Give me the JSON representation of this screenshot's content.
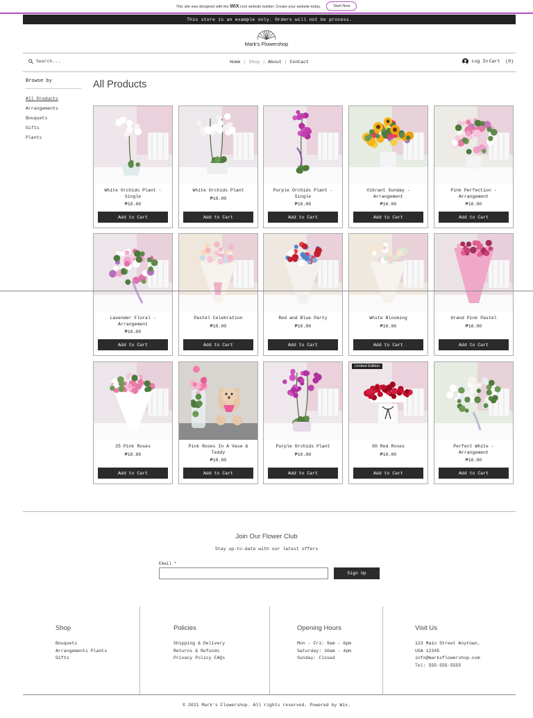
{
  "wix_bar": {
    "text_before": "This site was designed with the",
    "wix": "WiX",
    "text_after": ".com website builder. Create your website today.",
    "button": "Start Now"
  },
  "notice": "This store is an example only. Orders will not be process.",
  "brand": {
    "name": "Mark's Flowershop"
  },
  "nav": {
    "search_placeholder": "Search...",
    "menu": [
      "Home",
      "Shop",
      "About",
      "Contact"
    ],
    "login": "Log In",
    "cart": "Cart",
    "cart_count": "(0)"
  },
  "sidebar": {
    "title": "Browse by",
    "categories": [
      "All Products",
      "Arrangements",
      "Bouquets",
      "Gifts",
      "Plants"
    ]
  },
  "page_title": "All Products",
  "products": [
    {
      "name": "White Orchids Plant - Single",
      "price": "₱10.00",
      "kind": "orchid-white-single",
      "bg": "#eee6ea"
    },
    {
      "name": "White Orchids Plant",
      "price": "₱10.00",
      "kind": "orchid-white",
      "bg": "#ece8ec"
    },
    {
      "name": "Purple Orchids Plant - Single",
      "price": "₱10.00",
      "kind": "orchid-purple-single",
      "bg": "#eee8ec"
    },
    {
      "name": "Vibrant Sunday - Arrangement",
      "price": "₱10.00",
      "kind": "sunflower",
      "bg": "#e6ece2"
    },
    {
      "name": "Pink Perfection - Arrangement",
      "price": "₱10.00",
      "kind": "pink-mix",
      "bg": "#ecebe6"
    },
    {
      "name": "Lavender Floral - Arrangement",
      "price": "₱10.00",
      "kind": "lavender",
      "bg": "#ece6ea"
    },
    {
      "name": "Pastel Celebration",
      "price": "₱10.00",
      "kind": "pastel-bouquet",
      "bg": "#efe6dc"
    },
    {
      "name": "Red and Blue Party",
      "price": "₱10.00",
      "kind": "redblue-bouquet",
      "bg": "#eee8e0"
    },
    {
      "name": "White Blooming",
      "price": "₱10.00",
      "kind": "white-bouquet",
      "bg": "#efe8de"
    },
    {
      "name": "Grand Pink Pastel",
      "price": "₱10.00",
      "kind": "pink-bouquet",
      "bg": "#ebe2e6"
    },
    {
      "name": "25 Pink Roses",
      "price": "₱10.00",
      "kind": "pink-roses",
      "bg": "#ece6ea"
    },
    {
      "name": "Pink Roses In A Vase & Teddy",
      "price": "₱10.00",
      "kind": "teddy",
      "bg": "#d8d4d0"
    },
    {
      "name": "Purple Orchids Plant",
      "price": "₱10.00",
      "kind": "orchid-purple",
      "bg": "#eee8ec"
    },
    {
      "name": "50 Red Roses",
      "price": "₱10.00",
      "kind": "red-roses",
      "bg": "#efe6ea",
      "ribbon": "Limited Edition"
    },
    {
      "name": "Perfect White - Arrangement",
      "price": "₱10.00",
      "kind": "white-arrangement",
      "bg": "#e6ece2"
    }
  ],
  "add_to_cart": "Add to Cart",
  "club": {
    "title": "Join Our Flower Club",
    "subtitle": "Stay up-to-date with our latest offers",
    "email_label": "Email *",
    "signup": "Sign Up"
  },
  "footer": {
    "shop": {
      "title": "Shop",
      "lines": [
        "Bouquets",
        "Arrangements Plants",
        "Gifts"
      ]
    },
    "policies": {
      "title": "Policies",
      "lines": [
        "Shipping & Delivery",
        "Returns & Refunds",
        "Privacy Policy FAQs"
      ]
    },
    "hours": {
      "title": "Opening Hours",
      "lines": [
        "Mon - Fri: 9am - 6pm",
        "Saturday: 10am - 4pm",
        "Sunday: Closed"
      ]
    },
    "visit": {
      "title": "Visit Us",
      "lines": [
        "123 Main Street Anytown,",
        "USA 12345",
        "info@marksflowershop.com",
        "Tel: 555-555-5555"
      ]
    }
  },
  "copyright": "© 2021 Mark's Flowershop. All rights reserved. Powered by Wix."
}
